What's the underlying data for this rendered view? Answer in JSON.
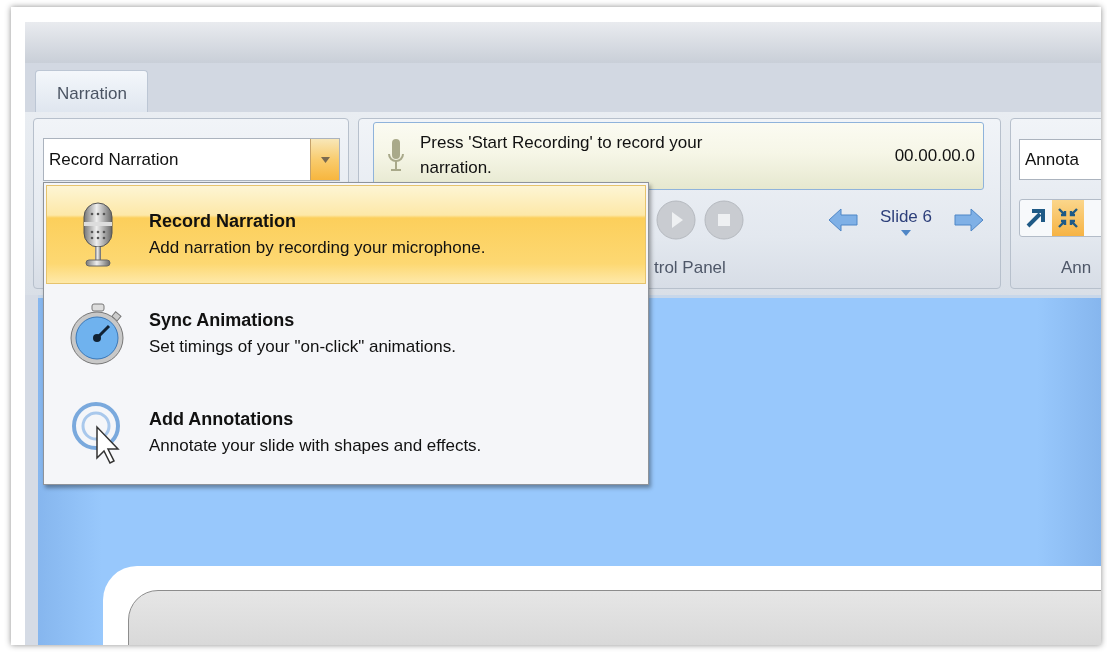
{
  "tabs": [
    {
      "label": "Narration",
      "selected": true
    }
  ],
  "mode_combo": {
    "value": "Record Narration"
  },
  "status": {
    "message": "Press 'Start Recording' to record your narration.",
    "time": "00.00.00.0"
  },
  "control_panel": {
    "slide": "Slide 6",
    "label": "trol Panel"
  },
  "annotations": {
    "combo_value": "Annota",
    "label": "Ann",
    "tools": [
      {
        "kind": "arrow",
        "selected": false
      },
      {
        "kind": "collapse",
        "selected": true
      }
    ]
  },
  "mode_menu": {
    "items": [
      {
        "kind": "microphone",
        "title": "Record Narration",
        "description": "Add narration by recording your microphone.",
        "selected": true
      },
      {
        "kind": "stopwatch",
        "title": "Sync Animations",
        "description": "Set timings of your \"on-click\" animations.",
        "selected": false
      },
      {
        "kind": "annotate",
        "title": "Add Annotations",
        "description": "Annotate your slide with shapes and effects.",
        "selected": false
      }
    ]
  }
}
